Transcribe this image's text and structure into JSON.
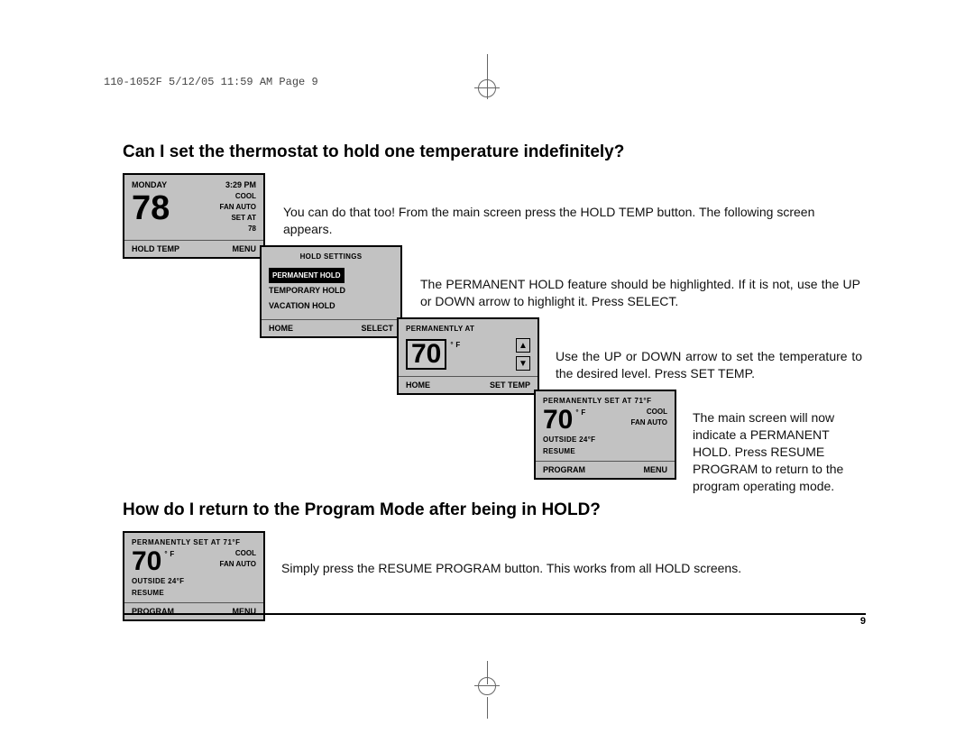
{
  "header_line": "110-1052F  5/12/05  11:59 AM  Page 9",
  "page_num": "9",
  "q1": "Can I set the thermostat to hold one temperature indefinitely?",
  "p1": "You can do that too! From the main screen press the HOLD TEMP button. The following screen appears.",
  "p2": "The PERMANENT HOLD feature should be highlighted. If it is not, use the UP or DOWN arrow to highlight it. Press SELECT.",
  "p3": "Use the UP or DOWN arrow to set the temperature to the desired level. Press SET TEMP.",
  "p4": "The main screen will now indicate a PERMANENT HOLD. Press RESUME PROGRAM to return to the program operating mode.",
  "q2": "How do I return to the Program Mode after being in HOLD?",
  "p5": "Simply press the RESUME PROGRAM button. This works from all HOLD screens.",
  "screen1": {
    "day": "MONDAY",
    "time": "3:29 PM",
    "temp": "78",
    "mode": "COOL",
    "fan": "FAN AUTO",
    "setat_label": "SET AT",
    "setat_val": "78",
    "left_btn": "HOLD TEMP",
    "right_btn": "MENU"
  },
  "screen2": {
    "title": "HOLD SETTINGS",
    "opt1": "PERMANENT HOLD",
    "opt2": "TEMPORARY HOLD",
    "opt3": "VACATION HOLD",
    "left_btn": "HOME",
    "right_btn": "SELECT"
  },
  "screen3": {
    "title": "PERMANENTLY AT",
    "temp": "70",
    "unit": "° F",
    "up": "▲",
    "down": "▼",
    "left_btn": "HOME",
    "right_btn": "SET TEMP"
  },
  "screen4": {
    "title": "PERMANENTLY SET AT 71°F",
    "temp": "70",
    "unit": "° F",
    "mode": "COOL",
    "fan": "FAN AUTO",
    "outside": "OUTSIDE 24°F",
    "resume1": "RESUME",
    "resume2": "PROGRAM",
    "menu": "MENU"
  },
  "screen5": {
    "title": "PERMANENTLY SET AT 71°F",
    "temp": "70",
    "unit": "° F",
    "mode": "COOL",
    "fan": "FAN AUTO",
    "outside": "OUTSIDE 24°F",
    "resume1": "RESUME",
    "resume2": "PROGRAM",
    "menu": "MENU"
  }
}
